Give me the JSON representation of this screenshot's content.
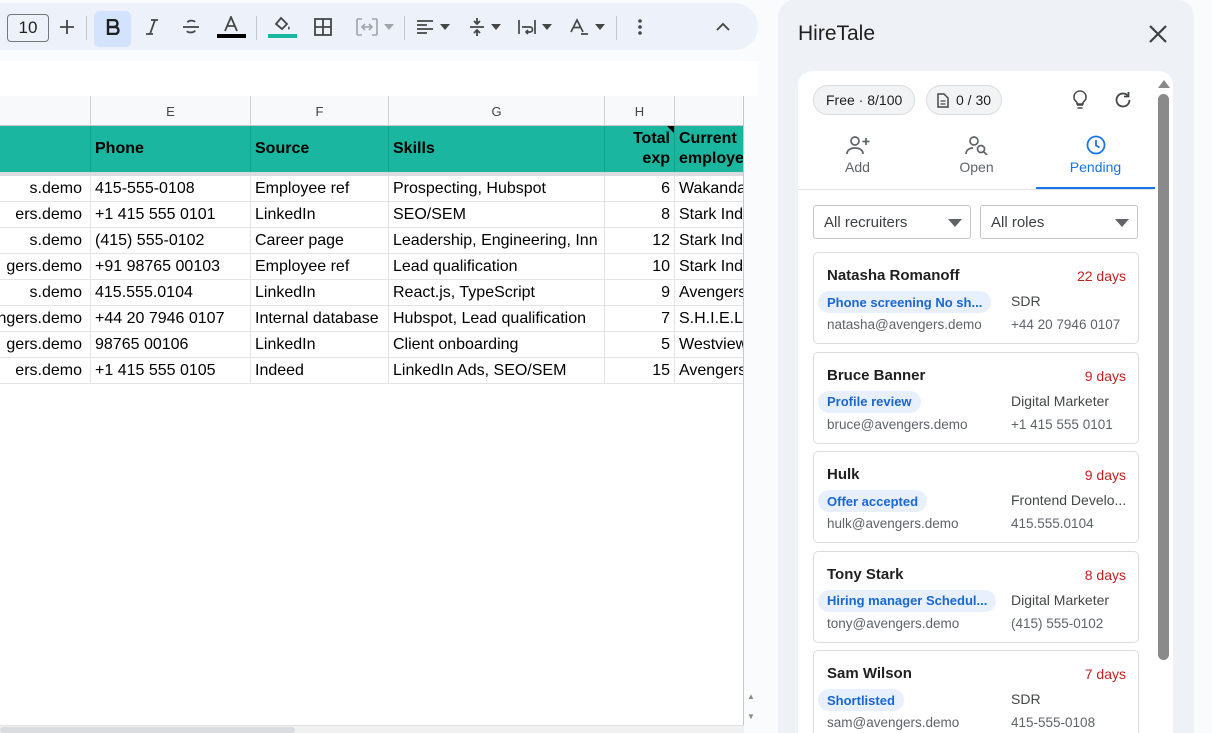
{
  "toolbar": {
    "font_size": "10",
    "buttons": {
      "increase_font": "plus-icon",
      "bold": "bold-icon",
      "italic": "italic-icon",
      "strikethrough": "strikethrough-icon",
      "text_color": "text-color-icon",
      "fill_color": "fill-color-icon",
      "borders": "borders-icon",
      "merge": "merge-cells-icon",
      "align": "align-left-icon",
      "valign": "vertical-align-icon",
      "wrap": "text-wrap-icon",
      "rotate": "text-rotation-icon",
      "more": "more-vert-icon",
      "collapse": "chevron-up-icon"
    },
    "fill_color_value": "#1ab69f",
    "text_color_value": "#000000"
  },
  "sheet": {
    "column_letters": [
      "",
      "E",
      "F",
      "G",
      "H",
      ""
    ],
    "header": [
      "",
      "Phone",
      "Source",
      "Skills",
      "Total exp",
      "Current employe"
    ],
    "rows": [
      [
        "s.demo",
        "415-555-0108",
        "Employee ref",
        "Prospecting, Hubspot",
        "6",
        "Wakanda"
      ],
      [
        "ers.demo",
        "+1 415 555 0101",
        "LinkedIn",
        "SEO/SEM",
        "8",
        "Stark Ind"
      ],
      [
        "s.demo",
        "(415) 555-0102",
        "Career page",
        "Leadership, Engineering, Inn",
        "12",
        "Stark Ind"
      ],
      [
        "gers.demo",
        "+91 98765 00103",
        "Employee ref",
        "Lead qualification",
        "10",
        "Stark Ind"
      ],
      [
        "s.demo",
        "415.555.0104",
        "LinkedIn",
        "React.js, TypeScript",
        "9",
        "Avengers"
      ],
      [
        "ngers.demo",
        "+44 20 7946 0107",
        "Internal database",
        "Hubspot, Lead qualification",
        "7",
        "S.H.I.E.L"
      ],
      [
        "gers.demo",
        "98765 00106",
        "LinkedIn",
        "Client onboarding",
        "5",
        "Westview"
      ],
      [
        "ers.demo",
        "+1 415 555 0105",
        "Indeed",
        "LinkedIn Ads, SEO/SEM",
        "15",
        "Avengers"
      ]
    ],
    "header_color": "#1ab69f"
  },
  "panel": {
    "title": "HireTale",
    "plan_label": "Free · 8/100",
    "doc_count": "0 / 30",
    "tabs": [
      {
        "label": "Add",
        "icon": "add-person-icon"
      },
      {
        "label": "Open",
        "icon": "person-search-icon"
      },
      {
        "label": "Pending",
        "icon": "clock-icon"
      }
    ],
    "active_tab": "Pending",
    "filters": {
      "recruiters": "All recruiters",
      "roles": "All roles"
    },
    "candidates": [
      {
        "name": "Natasha Romanoff",
        "days": "22 days",
        "status": "Phone screening No sh...",
        "role": "SDR",
        "email": "natasha@avengers.demo",
        "phone": "+44 20 7946 0107"
      },
      {
        "name": "Bruce Banner",
        "days": "9 days",
        "status": "Profile review",
        "role": "Digital Marketer",
        "email": "bruce@avengers.demo",
        "phone": "+1 415 555 0101"
      },
      {
        "name": "Hulk",
        "days": "9 days",
        "status": "Offer accepted",
        "role": "Frontend Develo...",
        "email": "hulk@avengers.demo",
        "phone": "415.555.0104"
      },
      {
        "name": "Tony Stark",
        "days": "8 days",
        "status": "Hiring manager Schedul...",
        "role": "Digital Marketer",
        "email": "tony@avengers.demo",
        "phone": "(415) 555-0102"
      },
      {
        "name": "Sam Wilson",
        "days": "7 days",
        "status": "Shortlisted",
        "role": "SDR",
        "email": "sam@avengers.demo",
        "phone": "415-555-0108"
      }
    ],
    "accent_color": "#1a73e8",
    "days_color": "#c5221f"
  }
}
